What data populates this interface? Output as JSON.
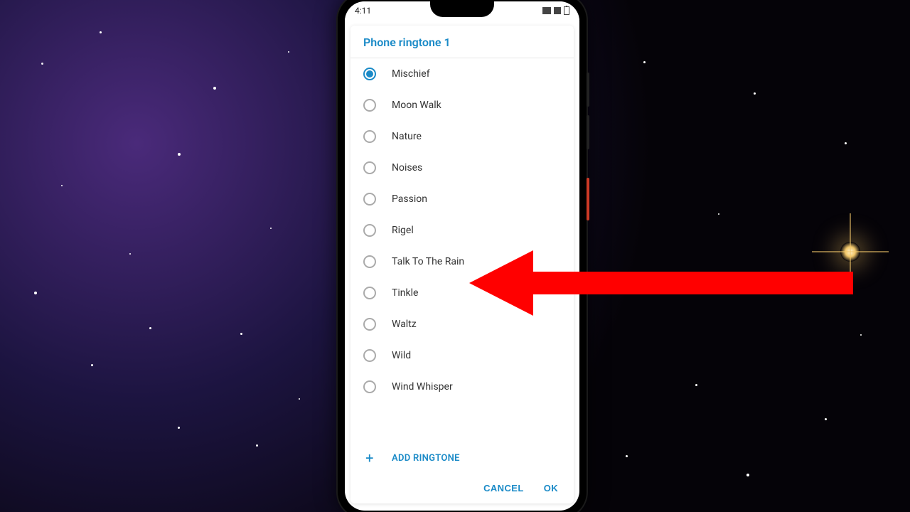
{
  "statusbar": {
    "time": "4:11"
  },
  "dialog": {
    "title": "Phone ringtone 1",
    "selected": 0,
    "items": [
      {
        "label": "Mischief"
      },
      {
        "label": "Moon Walk"
      },
      {
        "label": "Nature"
      },
      {
        "label": "Noises"
      },
      {
        "label": "Passion"
      },
      {
        "label": "Rigel"
      },
      {
        "label": "Talk To The Rain"
      },
      {
        "label": "Tinkle"
      },
      {
        "label": "Waltz"
      },
      {
        "label": "Wild"
      },
      {
        "label": "Wind Whisper"
      }
    ],
    "add_label": "ADD RINGTONE",
    "cancel_label": "CANCEL",
    "ok_label": "OK"
  }
}
